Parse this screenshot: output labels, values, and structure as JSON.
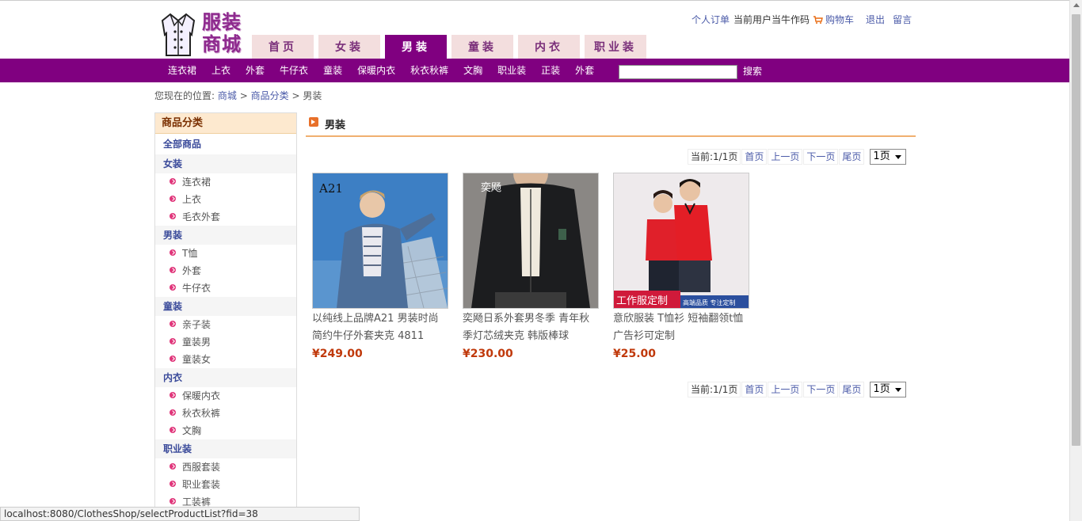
{
  "header": {
    "logo_text_line1": "服装",
    "logo_text_line2": "商城",
    "tabs": [
      {
        "label": "首页",
        "active": false
      },
      {
        "label": "女装",
        "active": false
      },
      {
        "label": "男装",
        "active": true
      },
      {
        "label": "童装",
        "active": false
      },
      {
        "label": "内衣",
        "active": false
      },
      {
        "label": "职业装",
        "active": false
      }
    ],
    "toplinks": {
      "orders": "个人订单",
      "current_user": "当前用户当牛作码",
      "cart": "购物车",
      "logout": "退出",
      "message": "留言"
    }
  },
  "navbar": {
    "items": [
      "连衣裙",
      "上衣",
      "外套",
      "牛仔衣",
      "童装",
      "保暖内衣",
      "秋衣秋裤",
      "文胸",
      "职业装",
      "正装",
      "外套"
    ],
    "search_value": "",
    "search_label": "搜索"
  },
  "breadcrumb": {
    "prefix": "您现在的位置:",
    "home": "商城",
    "sep1": ">",
    "category": "商品分类",
    "sep2": ">",
    "current": "男装"
  },
  "sidebar": {
    "title": "商品分类",
    "all": "全部商品",
    "groups": [
      {
        "name": "女装",
        "items": [
          "连衣裙",
          "上衣",
          "毛衣外套"
        ]
      },
      {
        "name": "男装",
        "items": [
          "T恤",
          "外套",
          "牛仔衣"
        ]
      },
      {
        "name": "童装",
        "items": [
          "亲子装",
          "童装男",
          "童装女"
        ]
      },
      {
        "name": "内衣",
        "items": [
          "保暖内衣",
          "秋衣秋裤",
          "文胸"
        ]
      },
      {
        "name": "职业装",
        "items": [
          "西服套装",
          "职业套装",
          "工装裤"
        ]
      }
    ]
  },
  "main": {
    "title": "男装",
    "pager": {
      "current": "当前:1/1页",
      "first": "首页",
      "prev": "上一页",
      "next": "下一页",
      "last": "尾页",
      "select_value": "1页"
    },
    "products": [
      {
        "name": "以纯线上品牌A21 男装时尚简约牛仔外套夹克 4811",
        "price": "¥249.00",
        "image_text": "A21"
      },
      {
        "name": "奕飏日系外套男冬季 青年秋季灯芯绒夹克 韩版棒球",
        "price": "¥230.00",
        "image_text": "奕飏"
      },
      {
        "name": "意欣服装 T恤衫 短袖翻领t恤广告衫可定制",
        "price": "¥25.00",
        "image_text": "工作服定制",
        "image_subtext": "高端品质 专注定制"
      }
    ]
  },
  "statusbar": {
    "url": "localhost:8080/ClothesShop/selectProductList?fid=38"
  },
  "colors": {
    "brand_purple": "#800080",
    "tab_inactive": "#f3dede",
    "price_red": "#c0390b",
    "link_blue": "#4a5aa8"
  }
}
